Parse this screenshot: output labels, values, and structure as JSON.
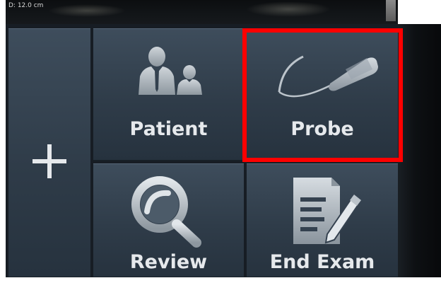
{
  "status": {
    "depth_label": "D: 12.0 cm"
  },
  "menu": {
    "add_icon": "plus-icon",
    "items": [
      {
        "label": "Patient",
        "icon": "patient-icon"
      },
      {
        "label": "Probe",
        "icon": "probe-icon"
      },
      {
        "label": "Review",
        "icon": "magnifier-icon"
      },
      {
        "label": "End Exam",
        "icon": "end-exam-icon"
      }
    ]
  },
  "highlight": {
    "target": "Probe",
    "color": "#ff0000"
  },
  "colors": {
    "tile": "#34414f",
    "text": "#e6e9ec",
    "panel": "#171d24"
  }
}
